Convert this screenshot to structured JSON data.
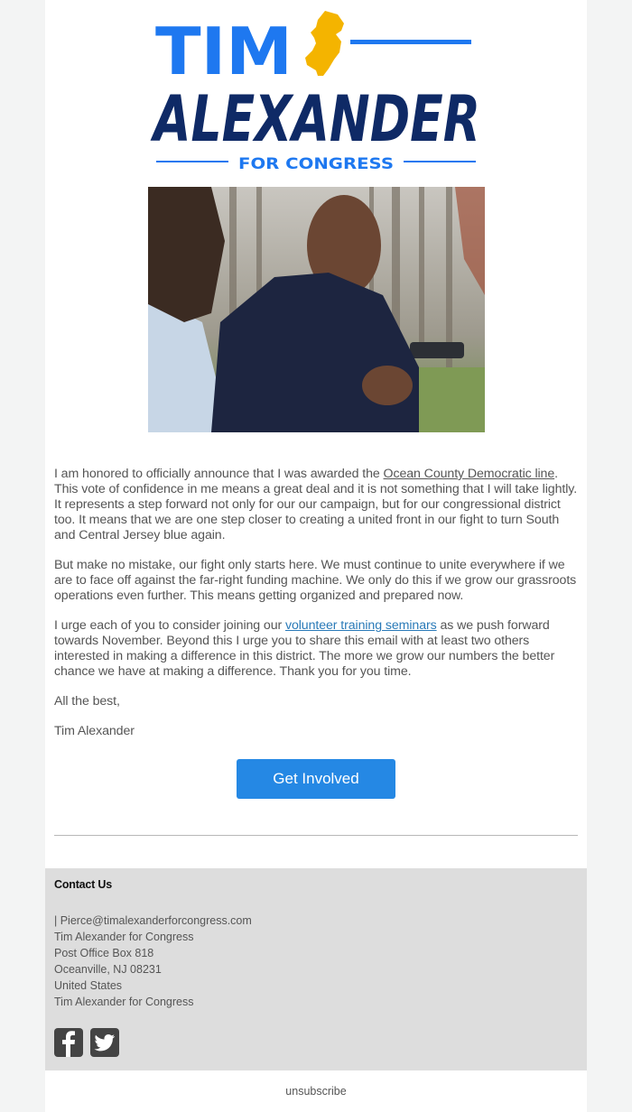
{
  "logo": {
    "line1": "TIM",
    "line2": "ALEXANDER",
    "tagline": "FOR CONGRESS",
    "colors": {
      "light_blue": "#1e78f0",
      "navy": "#0f2a66",
      "gold": "#f4b400"
    }
  },
  "photo": {
    "alt": "Tim Alexander speaking outdoors"
  },
  "body": {
    "p1_before": "I am honored to officially announce that I was awarded the ",
    "p1_link": "Ocean County Democratic line",
    "p1_after": ". This vote of confidence in me means a great deal and it is not something that I will take lightly. It represents a step forward not only for our our campaign, but for our congressional district too. It means that we are one step closer to creating a united front in our fight to turn South and Central Jersey blue again.",
    "p2": "But make no mistake, our fight only starts here. We must continue to unite everywhere if we are to face off against the far-right funding machine. We only do this if we grow our grassroots operations even further.  This means getting organized and prepared now.",
    "p3_before": "I urge each of you to consider joining our ",
    "p3_link": "volunteer training seminars",
    "p3_after": "  as we push forward towards November. Beyond this I urge you to share this email with at least two others interested in making a difference in this district. The more we grow our numbers the better chance we have at making a difference. Thank you for you time.",
    "closing": "All the best,",
    "signature": "Tim Alexander"
  },
  "cta": {
    "label": "Get Involved",
    "color": "#2588e4"
  },
  "footer": {
    "title": "Contact Us",
    "lines": [
      "| Pierce@timalexanderforcongress.com",
      "Tim Alexander for Congress",
      "Post Office Box 818",
      "Oceanville, NJ 08231",
      "United States",
      "Tim Alexander for Congress"
    ],
    "social": [
      {
        "icon": "facebook-icon"
      },
      {
        "icon": "twitter-icon"
      }
    ]
  },
  "unsubscribe": "unsubscribe"
}
